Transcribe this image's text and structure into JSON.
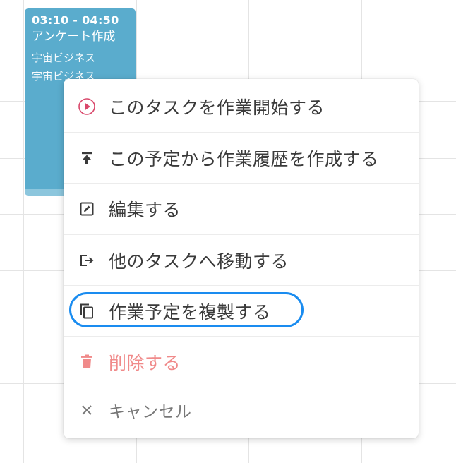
{
  "event": {
    "time": "03:10 - 04:50",
    "title": "アンケート作成",
    "detail_1": "宇宙ビジネス",
    "detail_2": "宇宙ビジネス"
  },
  "menu": {
    "items": [
      {
        "label": "このタスクを作業開始する",
        "icon": "play-circle-icon"
      },
      {
        "label": "この予定から作業履歴を作成する",
        "icon": "upload-arrow-icon"
      },
      {
        "label": "編集する",
        "icon": "edit-icon"
      },
      {
        "label": "他のタスクへ移動する",
        "icon": "move-out-icon"
      },
      {
        "label": "作業予定を複製する",
        "icon": "copy-icon"
      },
      {
        "label": "削除する",
        "icon": "trash-icon"
      },
      {
        "label": "キャンセル",
        "icon": "close-icon"
      }
    ]
  },
  "colors": {
    "event_bg": "#5aaccd",
    "accent_play": "#d9486b",
    "delete": "#f08a8a",
    "highlight": "#1a8cf0",
    "cancel": "#777777"
  }
}
